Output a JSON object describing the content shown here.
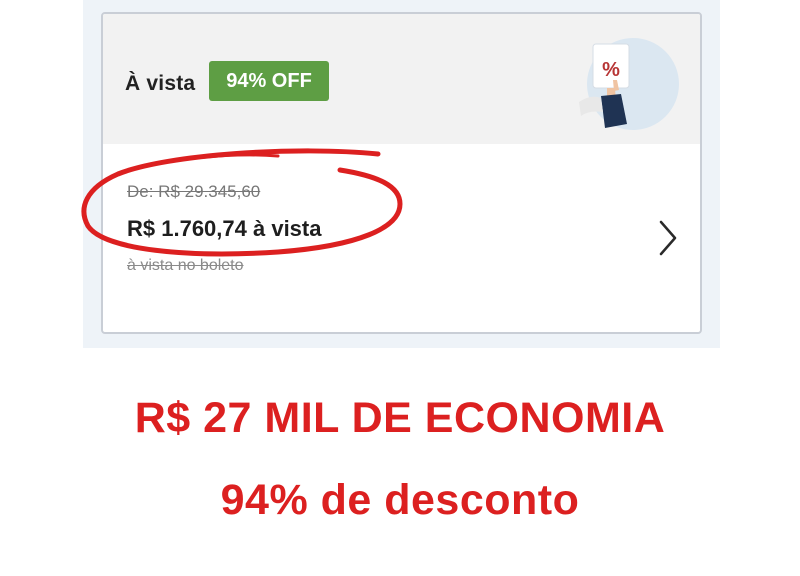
{
  "card": {
    "payment_label": "À vista",
    "discount_badge": "94% OFF",
    "promo_symbol": "%",
    "old_price": "De: R$ 29.345,60",
    "new_price": "R$ 1.760,74 à vista",
    "price_note": "à vista no boleto"
  },
  "promo": {
    "headline": "R$ 27 MIL DE ECONOMIA",
    "subheadline": "94% de desconto"
  },
  "colors": {
    "badge": "#5e9e44",
    "highlight": "#dc2020",
    "card_header": "#f2f2f2"
  },
  "icons": [
    "percent-tag-illustration",
    "chevron-right-icon"
  ]
}
